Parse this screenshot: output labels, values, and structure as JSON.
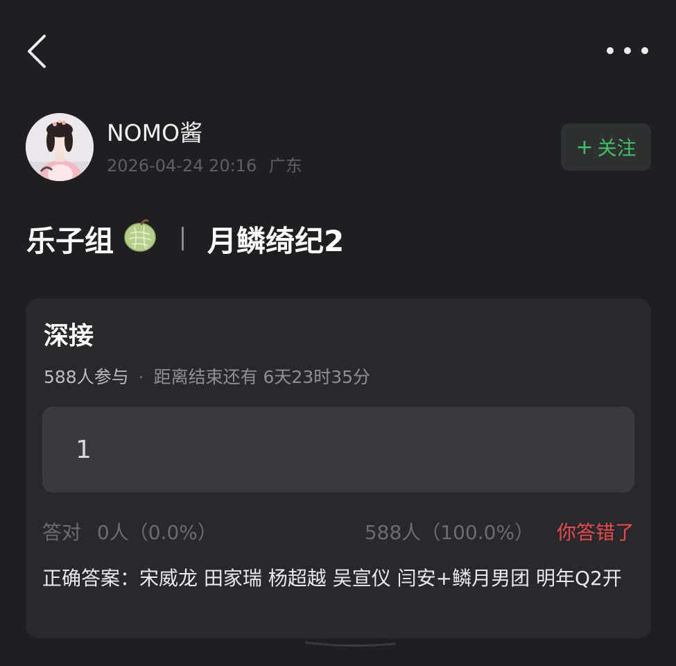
{
  "nav": {
    "back_icon": "chevron-left-icon",
    "more_icon": "more-horizontal-icon"
  },
  "author": {
    "name": "NOMO酱",
    "datetime": "2026-04-24 20:16",
    "location": "广东",
    "follow_label": "关注",
    "follow_icon": "plus-icon"
  },
  "post": {
    "title_left": "乐子组",
    "title_emoji": "🍈",
    "title_right": "月鳞绮纪2"
  },
  "quiz": {
    "title": "深接",
    "participants": "588人参与",
    "separator": "·",
    "countdown": "距离结束还有 6天23时35分",
    "answer_value": "1",
    "correct_label": "答对",
    "correct_count": "0人（0.0%）",
    "my_option_stats": "588人（100.0%）",
    "result_label": "你答错了",
    "correct_answer_text": "正确答案：宋威龙 田家瑞 杨超越 吴宣仪 闫安+鳞月男团 明年Q2开"
  },
  "colors": {
    "background": "#1f1f21",
    "card": "#29292c",
    "follow_green": "#3fbf6a",
    "wrong_red": "#e5484d"
  }
}
